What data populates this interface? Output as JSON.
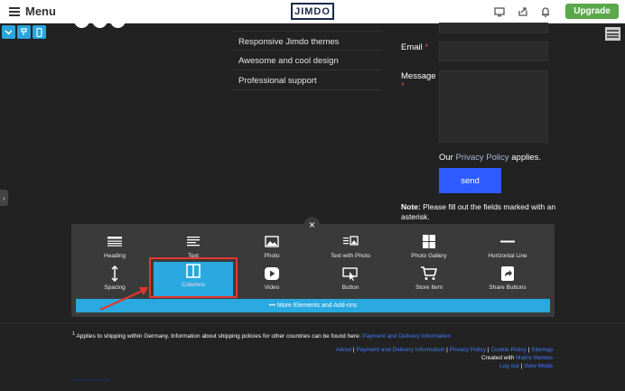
{
  "topbar": {
    "menu_label": "Menu",
    "logo_text": "JIMDO",
    "upgrade_label": "Upgrade",
    "icons": [
      "desktop-preview-icon",
      "share-icon",
      "bell-icon"
    ]
  },
  "features": [
    "Responsive Jimdo themes",
    "Awesome and cool design",
    "Professional support"
  ],
  "form": {
    "email_label": "Email",
    "message_label": "Message",
    "required_mark": "*",
    "policy_prefix": "Our",
    "policy_link": "Privacy Policy",
    "policy_suffix": "applies.",
    "send_label": "send",
    "note_bold": "Note:",
    "note_text": "Please fill out the fields marked with an asterisk."
  },
  "panel": {
    "close_label": "×",
    "elements": [
      {
        "label": "Heading",
        "icon": "heading-icon"
      },
      {
        "label": "Text",
        "icon": "text-icon"
      },
      {
        "label": "Photo",
        "icon": "photo-icon"
      },
      {
        "label": "Text with Photo",
        "icon": "text-with-photo-icon"
      },
      {
        "label": "Photo Gallery",
        "icon": "gallery-icon"
      },
      {
        "label": "Horizontal Line",
        "icon": "horizontal-line-icon"
      },
      {
        "label": "Spacing",
        "icon": "spacing-icon"
      },
      {
        "label": "Columns",
        "icon": "columns-icon"
      },
      {
        "label": "Video",
        "icon": "video-icon"
      },
      {
        "label": "Button",
        "icon": "button-icon"
      },
      {
        "label": "Store Item",
        "icon": "cart-icon"
      },
      {
        "label": "Share Buttons",
        "icon": "share-buttons-icon"
      }
    ],
    "more_label": "••• More Elements and Add-ons"
  },
  "footer": {
    "footnote_sup": "1",
    "footnote_text": "Applies to shipping within Germany. Information about shipping policies for other countries can be found here:",
    "footnote_link": "Payment and Delivery Information",
    "links": [
      "About",
      "Payment and Delivery Information",
      "Privacy Policy",
      "Cookie Policy",
      "Sitemap"
    ],
    "created_with": "Created with",
    "theme_link": "Matrix themes",
    "logout": "Log out",
    "view_mode": "View Mode"
  },
  "colors": {
    "accent": "#29a9e0",
    "upgrade": "#5aa84b",
    "send": "#2d5bff",
    "highlight": "#e3372e"
  }
}
